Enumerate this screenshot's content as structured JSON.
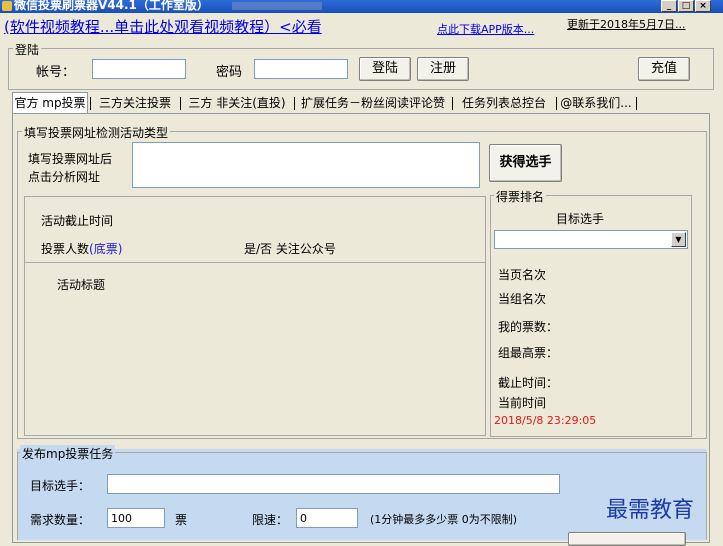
{
  "window": {
    "title": "微信投票刷票器V44.1（工作室版）"
  },
  "top_links": {
    "tutorial": "(软件视频教程...单击此处观看视频教程）<必看",
    "app_download": "点此下载APP版本...",
    "updated": "更新于2018年5月7日..."
  },
  "login": {
    "legend": "登陆",
    "account_label": "帐号：",
    "account_value": "",
    "password_label": "密码",
    "password_value": "",
    "login_button": "登陆",
    "register_button": "注册",
    "recharge_button": "充值"
  },
  "tabs": [
    {
      "label": "官方 mp投票"
    },
    {
      "label": "三方关注投票"
    },
    {
      "label": "三方 非关注(直投)"
    },
    {
      "label": "扩展任务－粉丝阅读评论赞"
    },
    {
      "label": "任务列表总控台"
    },
    {
      "label": "@联系我们..."
    }
  ],
  "detect": {
    "legend": "填写投票网址检测活动类型",
    "hint_line1": "填写投票网址后",
    "hint_line2": "点击分析网址",
    "url_value": "",
    "get_button": "获得选手"
  },
  "info": {
    "deadline_label": "活动截止时间",
    "voters_label": "投票人数",
    "voters_bottom": "(底票)",
    "follow_label": "是/否 关注公众号",
    "activity_title_label": "活动标题"
  },
  "ranking": {
    "legend": "得票排名",
    "target_label": "目标选手",
    "target_value": "",
    "page_rank": "当页名次",
    "group_rank": "当组名次",
    "my_votes": "我的票数：",
    "group_max": "组最高票：",
    "deadline": "截止时间：",
    "current_time_label": "当前时间",
    "current_time_value": "2018/5/8 23:29:05"
  },
  "publish": {
    "legend": "发布mp投票任务",
    "target_label": "目标选手：",
    "target_value": "",
    "quantity_label": "需求数量：",
    "quantity_value": "100",
    "quantity_unit": "票",
    "speed_label": "限速：",
    "speed_value": "0",
    "speed_hint": "(1分钟最多多少票 0为不限制)"
  },
  "watermark": "最需教育",
  "colors": {
    "title_bar": "#1a4fb8",
    "panel_bg": "#ece9d8",
    "publish_bg": "#c5d9f1",
    "link": "#0000ee",
    "time_red": "#e01818"
  }
}
